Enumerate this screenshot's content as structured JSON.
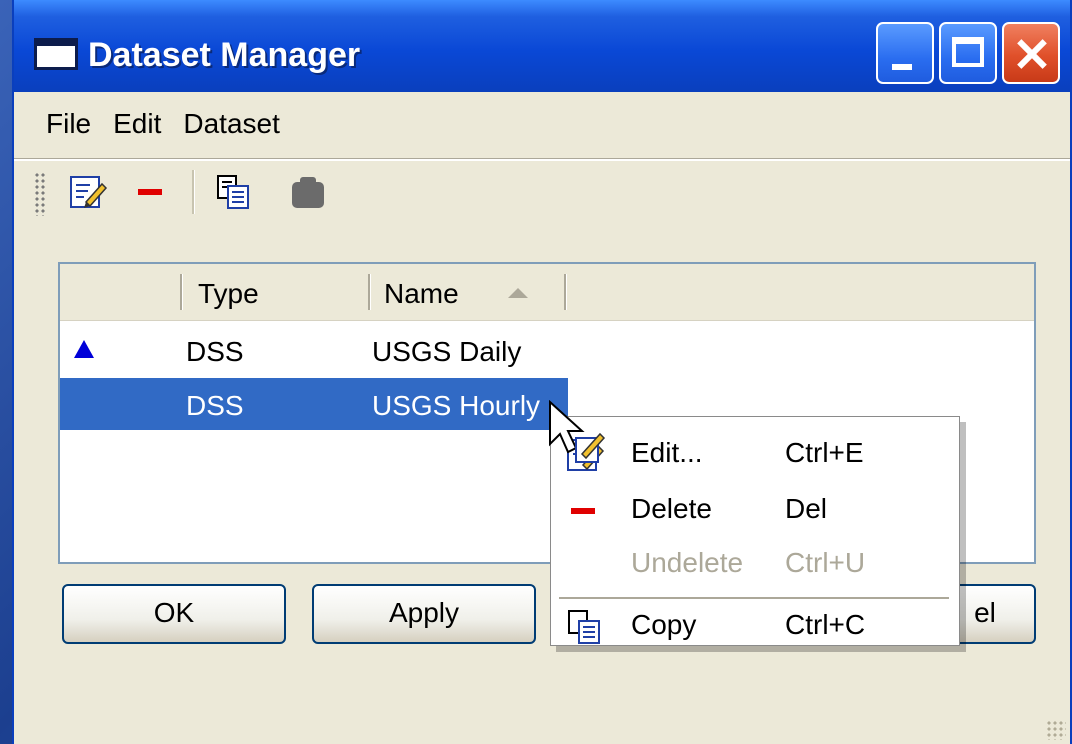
{
  "window": {
    "title": "Dataset Manager"
  },
  "menubar": {
    "items": [
      "File",
      "Edit",
      "Dataset"
    ]
  },
  "toolbar": {
    "icons": [
      "edit-icon",
      "delete-icon",
      "copy-icon",
      "paste-icon"
    ]
  },
  "list": {
    "columns": [
      "Type",
      "Name"
    ],
    "sort_column": "Name",
    "rows": [
      {
        "type": "DSS",
        "name": "USGS Daily",
        "marker": "triangle-up",
        "selected": false
      },
      {
        "type": "DSS",
        "name": "USGS Hourly",
        "marker": "",
        "selected": true
      }
    ]
  },
  "buttons": {
    "ok": "OK",
    "apply": "Apply",
    "cancel_visible": "el"
  },
  "context_menu": {
    "items": [
      {
        "label": "Edit...",
        "shortcut": "Ctrl+E",
        "icon": "edit-icon",
        "enabled": true
      },
      {
        "label": "Delete",
        "shortcut": "Del",
        "icon": "delete-icon",
        "enabled": true
      },
      {
        "label": "Undelete",
        "shortcut": "Ctrl+U",
        "icon": "",
        "enabled": false
      },
      {
        "label": "Copy",
        "shortcut": "Ctrl+C",
        "icon": "copy-icon",
        "enabled": true
      }
    ]
  },
  "colors": {
    "title_bar": "#0a48d6",
    "selection": "#316ac5",
    "delete_red": "#e00000",
    "marker_blue": "#0000d8",
    "disabled_text": "#aca899"
  }
}
